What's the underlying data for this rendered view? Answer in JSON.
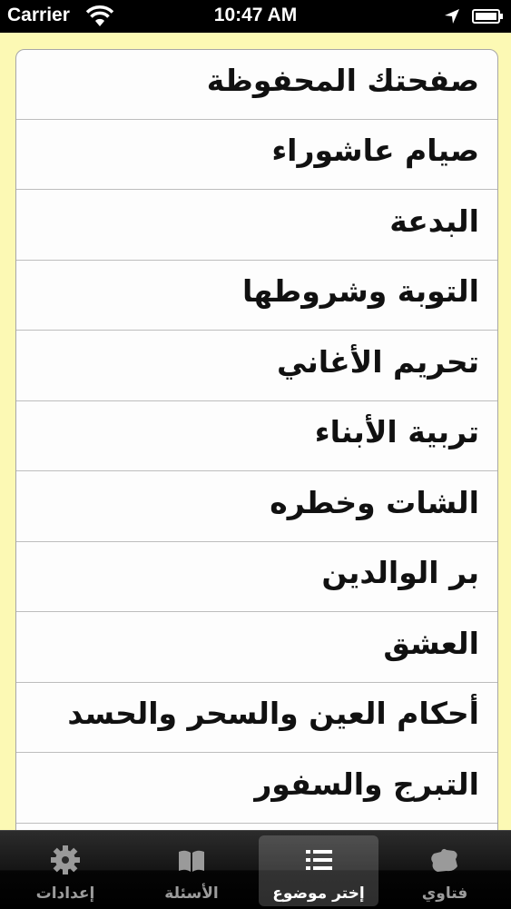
{
  "status_bar": {
    "carrier": "Carrier",
    "time": "10:47 AM"
  },
  "list": {
    "items": [
      {
        "label": "صفحتك المحفوظة"
      },
      {
        "label": "صيام عاشوراء"
      },
      {
        "label": "البدعة"
      },
      {
        "label": "التوبة وشروطها"
      },
      {
        "label": "تحريم الأغاني"
      },
      {
        "label": "تربية الأبناء"
      },
      {
        "label": "الشات وخطره"
      },
      {
        "label": "بر الوالدين"
      },
      {
        "label": "العشق"
      },
      {
        "label": "أحكام العين والسحر والحسد"
      },
      {
        "label": "التبرج والسفور"
      }
    ]
  },
  "tab_bar": {
    "tabs": [
      {
        "label": "إعدادات",
        "icon": "gear-icon"
      },
      {
        "label": "الأسئلة",
        "icon": "book-icon"
      },
      {
        "label": "إختر موضوع",
        "icon": "list-icon",
        "selected": true
      },
      {
        "label": "فتاوي",
        "icon": "puzzle-icon"
      }
    ]
  },
  "colors": {
    "background": "#fcf9b4",
    "list_background": "#fdfdfd",
    "tab_selected_text": "#ffffff",
    "tab_text": "#9c9c9c"
  }
}
